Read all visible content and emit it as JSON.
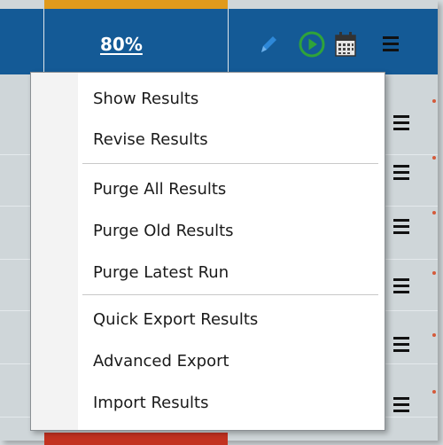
{
  "header": {
    "percent": "80%"
  },
  "icons": {
    "edit": "pencil-icon",
    "run": "play-circle-icon",
    "schedule": "calendar-icon",
    "menu": "hamburger-menu-icon"
  },
  "colors": {
    "header_bg": "#145a96",
    "progress_orange": "#e09a1c",
    "progress_red": "#c33220",
    "play_green": "#2fa33a",
    "pencil_blue": "#2e88d8"
  },
  "context_menu": {
    "groups": [
      [
        {
          "label": "Show Results"
        },
        {
          "label": "Revise Results"
        }
      ],
      [
        {
          "label": "Purge All Results"
        },
        {
          "label": "Purge Old Results"
        },
        {
          "label": "Purge Latest Run"
        }
      ],
      [
        {
          "label": "Quick Export Results"
        },
        {
          "label": "Advanced Export"
        },
        {
          "label": "Import Results"
        }
      ]
    ]
  }
}
